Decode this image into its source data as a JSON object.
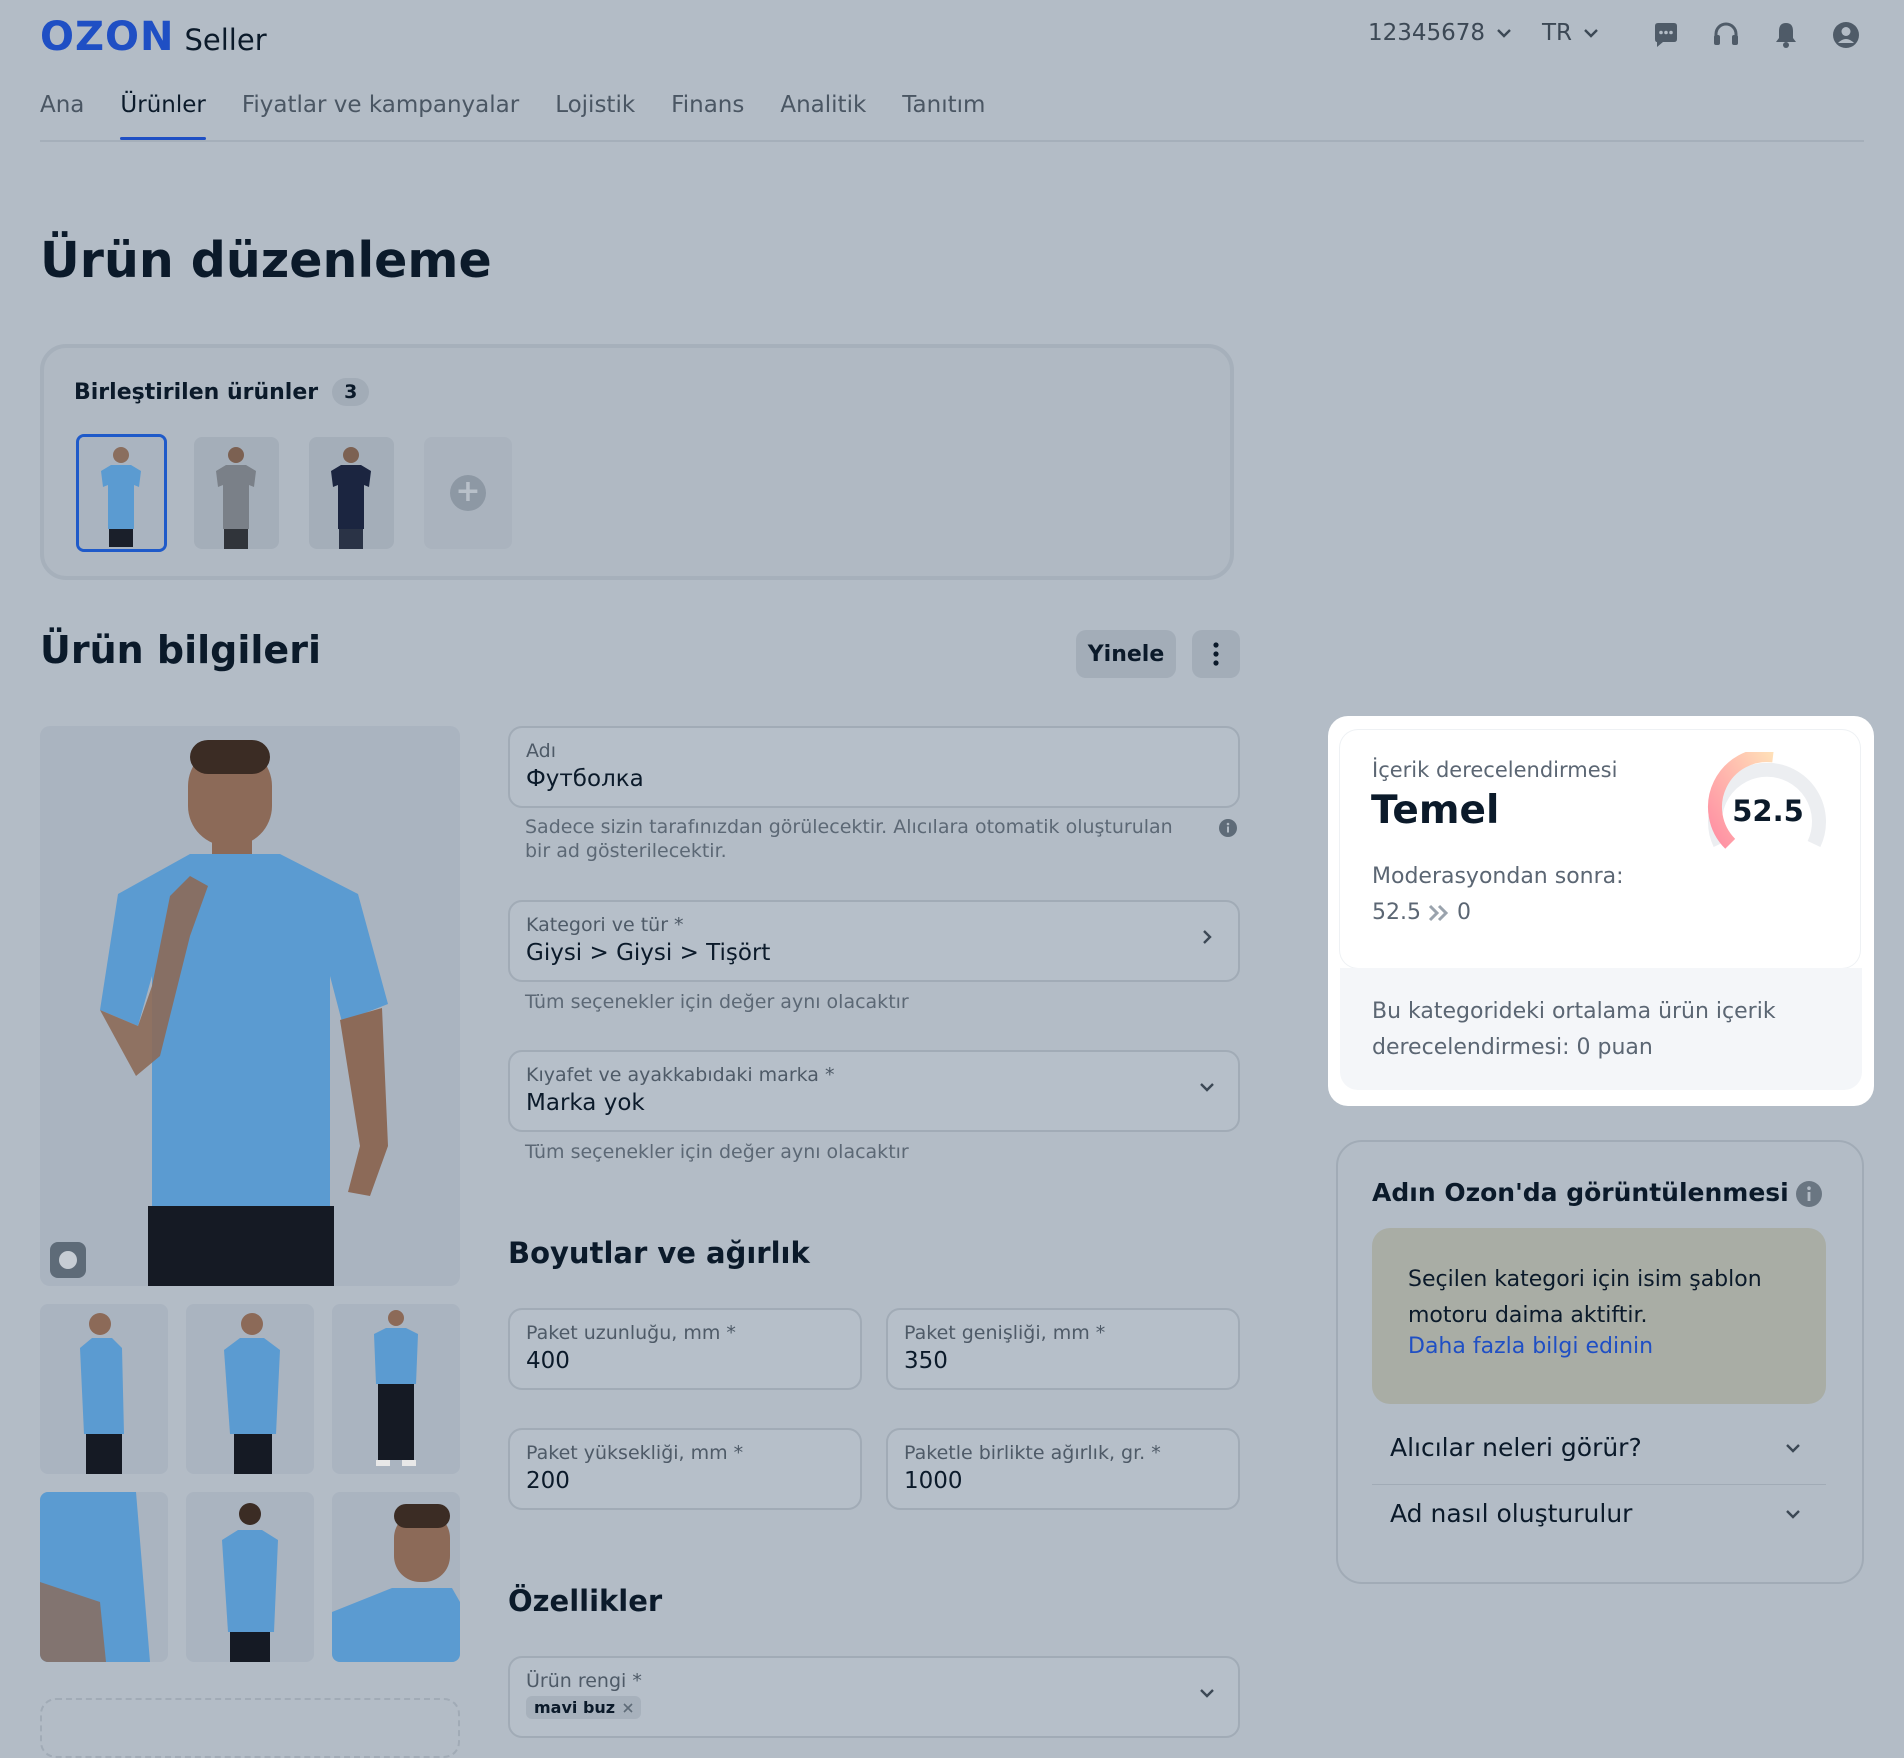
{
  "header": {
    "logo_brand": "OZON",
    "logo_product": "Seller",
    "account_id": "12345678",
    "language": "TR",
    "icons": [
      "chat-icon",
      "support-headset-icon",
      "bell-icon",
      "user-icon"
    ]
  },
  "nav": {
    "items": [
      "Ana",
      "Ürünler",
      "Fiyatlar ve kampanyalar",
      "Lojistik",
      "Finans",
      "Analitik",
      "Tanıtım"
    ],
    "active": "Ürünler"
  },
  "page": {
    "title": "Ürün düzenleme"
  },
  "merged": {
    "title": "Birleştirilen ürünler",
    "count": "3"
  },
  "product_info": {
    "title": "Ürün bilgileri",
    "refresh_label": "Yinele",
    "name_field": {
      "label": "Adı",
      "value": "Футболка",
      "hint": "Sadece sizin tarafınızdan görülecektir. Alıcılara otomatik oluşturulan bir ad gösterilecektir."
    },
    "category_field": {
      "label": "Kategori ve tür *",
      "value": "Giysi > Giysi > Tişört",
      "hint": "Tüm seçenekler için değer aynı olacaktır"
    },
    "brand_field": {
      "label": "Kıyafet ve ayakkabıdaki marka *",
      "value": "Marka yok",
      "hint": "Tüm seçenekler için değer aynı olacaktır"
    }
  },
  "dimensions": {
    "title": "Boyutlar ve ağırlık",
    "length": {
      "label": "Paket uzunluğu, mm *",
      "value": "400"
    },
    "width": {
      "label": "Paket genişliği, mm *",
      "value": "350"
    },
    "height": {
      "label": "Paket yüksekliği, mm *",
      "value": "200"
    },
    "weight": {
      "label": "Paketle birlikte ağırlık, gr. *",
      "value": "1000"
    }
  },
  "features": {
    "title": "Özellikler",
    "color_field": {
      "label": "Ürün rengi *",
      "chip": "mavi buz"
    }
  },
  "rating": {
    "label": "İçerik derecelendirmesi",
    "level": "Temel",
    "score": "52.5",
    "score_fraction": 0.525,
    "after_label": "Moderasyondan sonra:",
    "after_from": "52.5",
    "after_to": "0",
    "average_text": "Bu kategorideki ortalama ürün içerik derecelendirmesi: 0 puan"
  },
  "name_display": {
    "title": "Adın Ozon'da görüntülenmesi",
    "note": "Seçilen kategori için isim şablon motoru daima aktiftir.",
    "link": "Daha fazla bilgi edinin",
    "accordion": [
      "Alıcılar neleri görür?",
      "Ad nasıl oluşturulur"
    ]
  },
  "colors": {
    "accent": "#1f4fc4",
    "shirt": "#5b9bd1"
  }
}
